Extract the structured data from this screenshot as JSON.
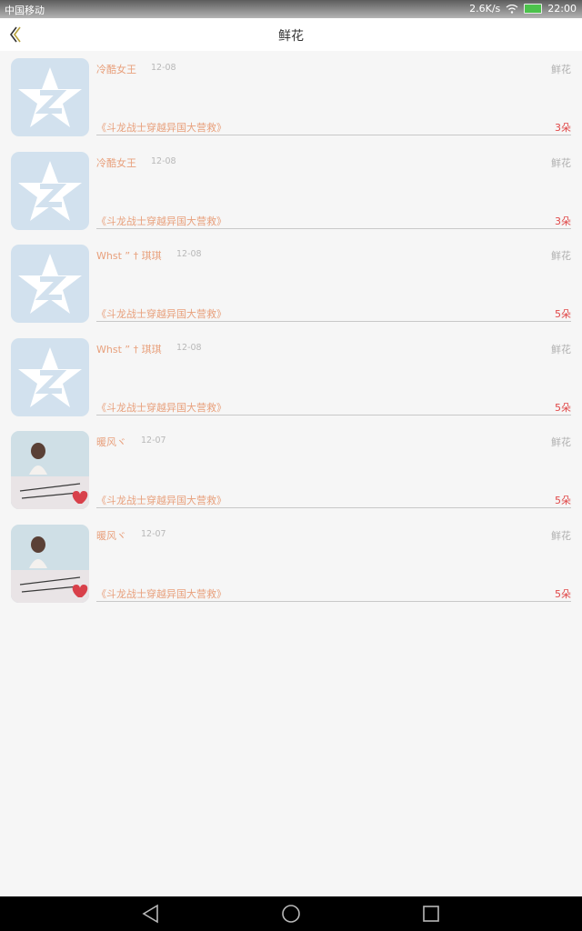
{
  "status_bar": {
    "carrier": "中国移动",
    "net_speed": "2.6K/s",
    "time": "22:00"
  },
  "nav": {
    "title": "鲜花"
  },
  "items": [
    {
      "name": "冷酷女王",
      "date": "12-08",
      "type": "鲜花",
      "book": "《斗龙战士穿越异国大营救》",
      "count": "3朵",
      "avatar": "qq-logo"
    },
    {
      "name": "冷酷女王",
      "date": "12-08",
      "type": "鲜花",
      "book": "《斗龙战士穿越异国大营救》",
      "count": "3朵",
      "avatar": "qq-logo"
    },
    {
      "name": "Whst ” † 琪琪",
      "date": "12-08",
      "type": "鲜花",
      "book": "《斗龙战士穿越异国大营救》",
      "count": "5朵",
      "avatar": "qq-logo"
    },
    {
      "name": "Whst ” † 琪琪",
      "date": "12-08",
      "type": "鲜花",
      "book": "《斗龙战士穿越异国大营救》",
      "count": "5朵",
      "avatar": "qq-logo"
    },
    {
      "name": "暖风ヾ",
      "date": "12-07",
      "type": "鲜花",
      "book": "《斗龙战士穿越异国大营救》",
      "count": "5朵",
      "avatar": "photo"
    },
    {
      "name": "暖风ヾ",
      "date": "12-07",
      "type": "鲜花",
      "book": "《斗龙战士穿越异国大营救》",
      "count": "5朵",
      "avatar": "photo"
    }
  ],
  "colors": {
    "accent": "#e8a07c",
    "count": "#e04848",
    "background": "#f6f6f6"
  },
  "icons": [
    "back-chevron-icon",
    "wifi-icon",
    "battery-icon",
    "qq-logo",
    "back-triangle-icon",
    "home-circle-icon",
    "recents-square-icon"
  ]
}
